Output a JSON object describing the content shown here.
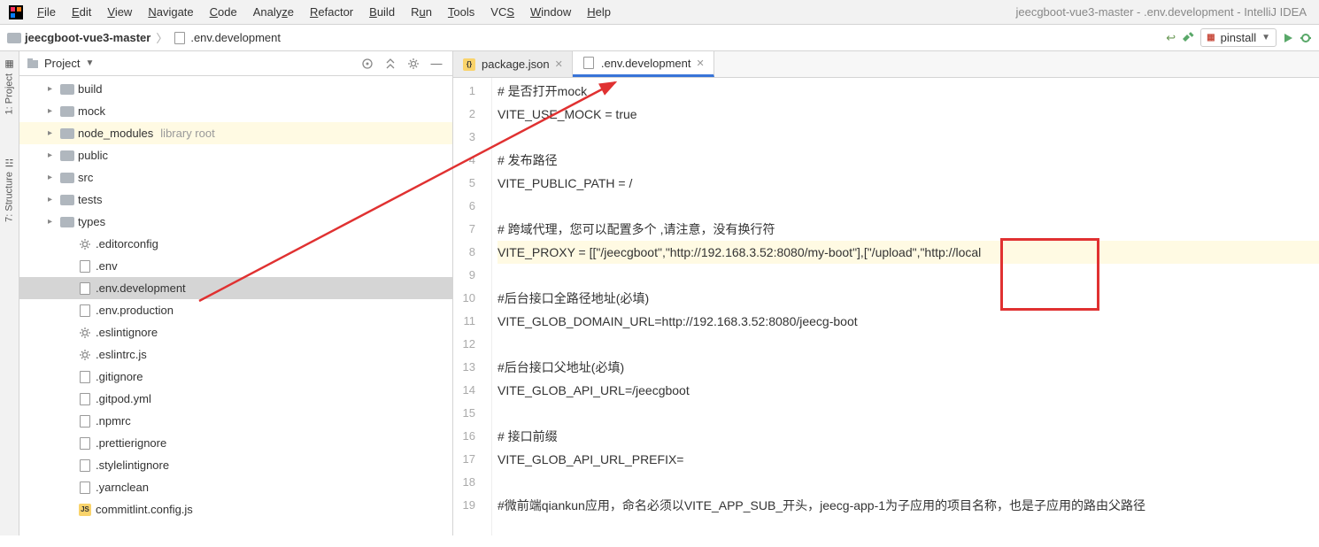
{
  "window_title": "jeecgboot-vue3-master - .env.development - IntelliJ IDEA",
  "menu": [
    "File",
    "Edit",
    "View",
    "Navigate",
    "Code",
    "Analyze",
    "Refactor",
    "Build",
    "Run",
    "Tools",
    "VCS",
    "Window",
    "Help"
  ],
  "breadcrumb": {
    "root": "jeecgboot-vue3-master",
    "file": ".env.development"
  },
  "run_config": "pinstall",
  "toolwindows": {
    "project": "1: Project",
    "structure": "7: Structure"
  },
  "project_panel": {
    "title": "Project"
  },
  "tree": [
    {
      "type": "folder",
      "name": "build",
      "level": 1,
      "expand": true
    },
    {
      "type": "folder",
      "name": "mock",
      "level": 1,
      "expand": true
    },
    {
      "type": "folder",
      "name": "node_modules",
      "level": 1,
      "expand": true,
      "note": "library root",
      "hl": true
    },
    {
      "type": "folder",
      "name": "public",
      "level": 1,
      "expand": true
    },
    {
      "type": "folder",
      "name": "src",
      "level": 1,
      "expand": true
    },
    {
      "type": "folder",
      "name": "tests",
      "level": 1,
      "expand": true
    },
    {
      "type": "folder",
      "name": "types",
      "level": 1,
      "expand": true
    },
    {
      "type": "gear",
      "name": ".editorconfig",
      "level": 2
    },
    {
      "type": "file",
      "name": ".env",
      "level": 2
    },
    {
      "type": "file",
      "name": ".env.development",
      "level": 2,
      "sel": true
    },
    {
      "type": "file",
      "name": ".env.production",
      "level": 2
    },
    {
      "type": "gear",
      "name": ".eslintignore",
      "level": 2
    },
    {
      "type": "gear",
      "name": ".eslintrc.js",
      "level": 2
    },
    {
      "type": "file",
      "name": ".gitignore",
      "level": 2
    },
    {
      "type": "file",
      "name": ".gitpod.yml",
      "level": 2
    },
    {
      "type": "file",
      "name": ".npmrc",
      "level": 2
    },
    {
      "type": "file",
      "name": ".prettierignore",
      "level": 2
    },
    {
      "type": "file",
      "name": ".stylelintignore",
      "level": 2
    },
    {
      "type": "file",
      "name": ".yarnclean",
      "level": 2
    },
    {
      "type": "json",
      "name": "commitlint.config.js",
      "level": 2
    }
  ],
  "tabs": [
    {
      "label": "package.json",
      "active": false,
      "closable": true,
      "icon": "json"
    },
    {
      "label": ".env.development",
      "active": true,
      "closable": true,
      "icon": "file"
    }
  ],
  "code_lines": [
    "# 是否打开mock",
    "VITE_USE_MOCK = true",
    "",
    "# 发布路径",
    "VITE_PUBLIC_PATH = /",
    "",
    "# 跨域代理，您可以配置多个 ,请注意，没有换行符",
    "VITE_PROXY = [[\"/jeecgboot\",\"http://192.168.3.52:8080/my-boot\"],[\"/upload\",\"http://local",
    "",
    "#后台接口全路径地址(必填)",
    "VITE_GLOB_DOMAIN_URL=http://192.168.3.52:8080/jeecg-boot",
    "",
    "#后台接口父地址(必填)",
    "VITE_GLOB_API_URL=/jeecgboot",
    "",
    "# 接口前缀",
    "VITE_GLOB_API_URL_PREFIX=",
    "",
    "#微前端qiankun应用，命名必须以VITE_APP_SUB_开头，jeecg-app-1为子应用的项目名称，也是子应用的路由父路径"
  ],
  "caret_line": 8
}
